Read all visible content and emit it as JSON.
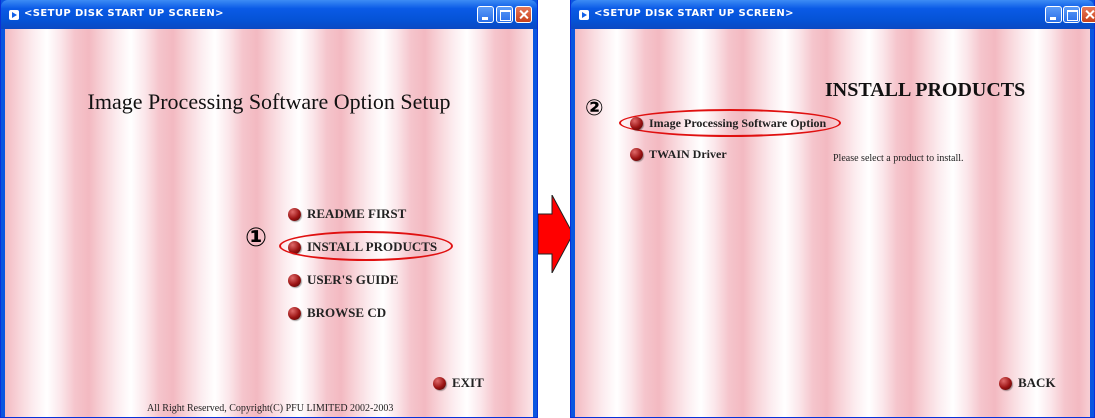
{
  "windows": [
    {
      "title": "<SETUP DISK START UP SCREEN>",
      "heading": "Image Processing Software Option Setup",
      "step_marker": "①",
      "menu": [
        "README FIRST",
        "INSTALL PRODUCTS",
        "USER'S GUIDE",
        "BROWSE CD"
      ],
      "exit_label": "EXIT",
      "copyright": "All Right Reserved, Copyright(C) PFU LIMITED 2002-2003"
    },
    {
      "title": "<SETUP DISK START UP SCREEN>",
      "heading": "INSTALL PRODUCTS",
      "step_marker": "②",
      "products": [
        "Image Processing Software Option",
        "TWAIN Driver"
      ],
      "instruction": "Please select a product to install.",
      "back_label": "BACK"
    }
  ],
  "colors": {
    "title_bar": "#0a5ae6",
    "highlight_ring": "#e01010",
    "arrow": "#ff0000"
  },
  "icons": {
    "arrow": "right-arrow-icon",
    "bullet": "red-bullet-icon"
  }
}
